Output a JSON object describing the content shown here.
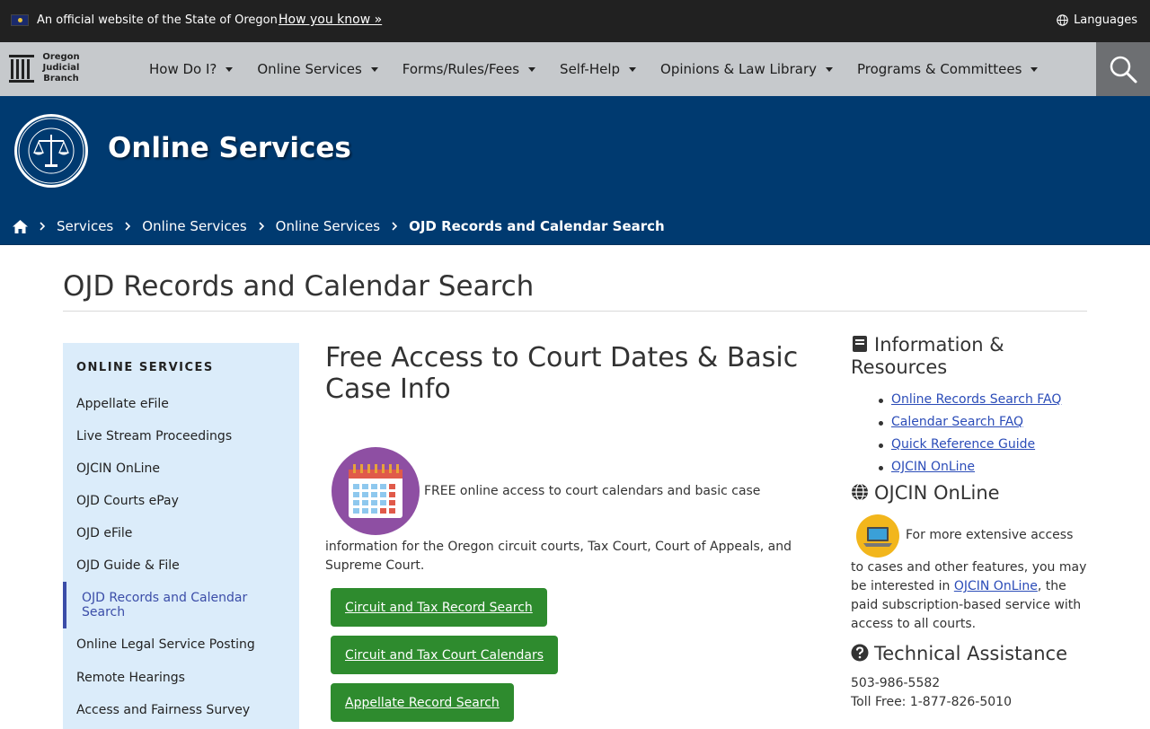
{
  "banner": {
    "official_text": "An official website of the State of Oregon",
    "how_you_know": "How you know »",
    "languages": "Languages"
  },
  "brand": {
    "line1": "Oregon",
    "line2": "Judicial",
    "line3": "Branch"
  },
  "nav": {
    "items": [
      {
        "label": "How Do I?"
      },
      {
        "label": "Online Services"
      },
      {
        "label": "Forms/Rules/Fees"
      },
      {
        "label": "Self-Help"
      },
      {
        "label": "Opinions & Law Library"
      },
      {
        "label": "Programs & Committees"
      }
    ]
  },
  "hero": {
    "title": "Online Services"
  },
  "breadcrumb": {
    "items": [
      "Services",
      "Online Services",
      "Online Services"
    ],
    "current": "OJD Records and Calendar Search"
  },
  "page": {
    "title": "OJD Records and Calendar Search"
  },
  "sidebar": {
    "heading": "ONLINE SERVICES",
    "items": [
      {
        "label": "Appellate eFile"
      },
      {
        "label": "Live Stream Proceedings"
      },
      {
        "label": "OJCIN OnLine"
      },
      {
        "label": "OJD Courts ePay"
      },
      {
        "label": "OJD eFile"
      },
      {
        "label": "OJD Guide & File"
      },
      {
        "label": "OJD Records and Calendar Search"
      },
      {
        "label": "Online Legal Service Posting"
      },
      {
        "label": "Remote Hearings"
      },
      {
        "label": "Access and Fairness Survey"
      }
    ]
  },
  "main": {
    "heading": "Free Access to Court Dates & Basic Case Info",
    "intro_line1": "FREE online access to court calendars and basic case",
    "intro_line2": "information for the Oregon circuit courts, Tax Court, Court of Appeals, and Supreme Court.",
    "buttons": [
      {
        "label": "Circuit and Tax Record Search"
      },
      {
        "label": "Circuit and Tax Court Calendars"
      },
      {
        "label": "Appellate Record Search"
      }
    ],
    "colors": {
      "button": "#2e8b2e",
      "hero": "#003a70",
      "sidebar": "#dbecfa"
    }
  },
  "right": {
    "info_heading": "Information & Resources",
    "info_links": [
      {
        "label": "Online Records Search FAQ"
      },
      {
        "label": "Calendar Search FAQ"
      },
      {
        "label": "Quick Reference Guide"
      },
      {
        "label": "OJCIN OnLine"
      }
    ],
    "ojcin_heading": "OJCIN OnLine",
    "ojcin_line1": "For more extensive access",
    "ojcin_pre": "to cases and other features, you may be interested in ",
    "ojcin_link": "OJCIN OnLine",
    "ojcin_post": ", the paid subscription-based service with access to all courts.",
    "tech_heading": "Technical Assistance",
    "tech_phone": "503-986-5582",
    "tech_tollfree": "Toll Free: 1-877-826-5010"
  }
}
